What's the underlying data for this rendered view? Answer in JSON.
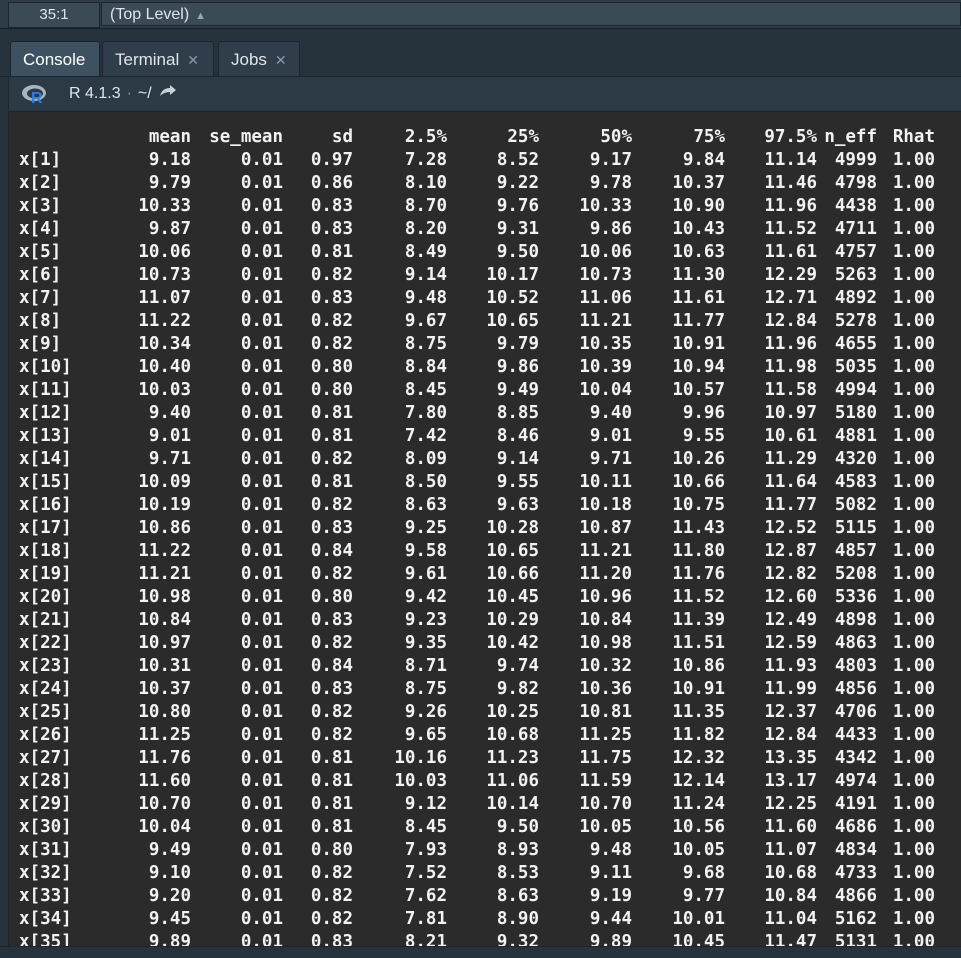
{
  "editor_status": {
    "cursor_position": "35:1",
    "scope": "(Top Level)"
  },
  "tabs": [
    {
      "label": "Console",
      "active": true,
      "closable": false
    },
    {
      "label": "Terminal",
      "active": false,
      "closable": true
    },
    {
      "label": "Jobs",
      "active": false,
      "closable": true
    }
  ],
  "console_toolbar": {
    "r_version": "R 4.1.3",
    "separator": "·",
    "working_dir": "~/"
  },
  "output": {
    "headers": [
      "",
      "mean",
      "se_mean",
      "sd",
      "2.5%",
      "25%",
      "50%",
      "75%",
      "97.5%",
      "n_eff",
      "Rhat"
    ],
    "rows": [
      [
        "x[1]",
        "9.18",
        "0.01",
        "0.97",
        "7.28",
        "8.52",
        "9.17",
        "9.84",
        "11.14",
        "4999",
        "1.00"
      ],
      [
        "x[2]",
        "9.79",
        "0.01",
        "0.86",
        "8.10",
        "9.22",
        "9.78",
        "10.37",
        "11.46",
        "4798",
        "1.00"
      ],
      [
        "x[3]",
        "10.33",
        "0.01",
        "0.83",
        "8.70",
        "9.76",
        "10.33",
        "10.90",
        "11.96",
        "4438",
        "1.00"
      ],
      [
        "x[4]",
        "9.87",
        "0.01",
        "0.83",
        "8.20",
        "9.31",
        "9.86",
        "10.43",
        "11.52",
        "4711",
        "1.00"
      ],
      [
        "x[5]",
        "10.06",
        "0.01",
        "0.81",
        "8.49",
        "9.50",
        "10.06",
        "10.63",
        "11.61",
        "4757",
        "1.00"
      ],
      [
        "x[6]",
        "10.73",
        "0.01",
        "0.82",
        "9.14",
        "10.17",
        "10.73",
        "11.30",
        "12.29",
        "5263",
        "1.00"
      ],
      [
        "x[7]",
        "11.07",
        "0.01",
        "0.83",
        "9.48",
        "10.52",
        "11.06",
        "11.61",
        "12.71",
        "4892",
        "1.00"
      ],
      [
        "x[8]",
        "11.22",
        "0.01",
        "0.82",
        "9.67",
        "10.65",
        "11.21",
        "11.77",
        "12.84",
        "5278",
        "1.00"
      ],
      [
        "x[9]",
        "10.34",
        "0.01",
        "0.82",
        "8.75",
        "9.79",
        "10.35",
        "10.91",
        "11.96",
        "4655",
        "1.00"
      ],
      [
        "x[10]",
        "10.40",
        "0.01",
        "0.80",
        "8.84",
        "9.86",
        "10.39",
        "10.94",
        "11.98",
        "5035",
        "1.00"
      ],
      [
        "x[11]",
        "10.03",
        "0.01",
        "0.80",
        "8.45",
        "9.49",
        "10.04",
        "10.57",
        "11.58",
        "4994",
        "1.00"
      ],
      [
        "x[12]",
        "9.40",
        "0.01",
        "0.81",
        "7.80",
        "8.85",
        "9.40",
        "9.96",
        "10.97",
        "5180",
        "1.00"
      ],
      [
        "x[13]",
        "9.01",
        "0.01",
        "0.81",
        "7.42",
        "8.46",
        "9.01",
        "9.55",
        "10.61",
        "4881",
        "1.00"
      ],
      [
        "x[14]",
        "9.71",
        "0.01",
        "0.82",
        "8.09",
        "9.14",
        "9.71",
        "10.26",
        "11.29",
        "4320",
        "1.00"
      ],
      [
        "x[15]",
        "10.09",
        "0.01",
        "0.81",
        "8.50",
        "9.55",
        "10.11",
        "10.66",
        "11.64",
        "4583",
        "1.00"
      ],
      [
        "x[16]",
        "10.19",
        "0.01",
        "0.82",
        "8.63",
        "9.63",
        "10.18",
        "10.75",
        "11.77",
        "5082",
        "1.00"
      ],
      [
        "x[17]",
        "10.86",
        "0.01",
        "0.83",
        "9.25",
        "10.28",
        "10.87",
        "11.43",
        "12.52",
        "5115",
        "1.00"
      ],
      [
        "x[18]",
        "11.22",
        "0.01",
        "0.84",
        "9.58",
        "10.65",
        "11.21",
        "11.80",
        "12.87",
        "4857",
        "1.00"
      ],
      [
        "x[19]",
        "11.21",
        "0.01",
        "0.82",
        "9.61",
        "10.66",
        "11.20",
        "11.76",
        "12.82",
        "5208",
        "1.00"
      ],
      [
        "x[20]",
        "10.98",
        "0.01",
        "0.80",
        "9.42",
        "10.45",
        "10.96",
        "11.52",
        "12.60",
        "5336",
        "1.00"
      ],
      [
        "x[21]",
        "10.84",
        "0.01",
        "0.83",
        "9.23",
        "10.29",
        "10.84",
        "11.39",
        "12.49",
        "4898",
        "1.00"
      ],
      [
        "x[22]",
        "10.97",
        "0.01",
        "0.82",
        "9.35",
        "10.42",
        "10.98",
        "11.51",
        "12.59",
        "4863",
        "1.00"
      ],
      [
        "x[23]",
        "10.31",
        "0.01",
        "0.84",
        "8.71",
        "9.74",
        "10.32",
        "10.86",
        "11.93",
        "4803",
        "1.00"
      ],
      [
        "x[24]",
        "10.37",
        "0.01",
        "0.83",
        "8.75",
        "9.82",
        "10.36",
        "10.91",
        "11.99",
        "4856",
        "1.00"
      ],
      [
        "x[25]",
        "10.80",
        "0.01",
        "0.82",
        "9.26",
        "10.25",
        "10.81",
        "11.35",
        "12.37",
        "4706",
        "1.00"
      ],
      [
        "x[26]",
        "11.25",
        "0.01",
        "0.82",
        "9.65",
        "10.68",
        "11.25",
        "11.82",
        "12.84",
        "4433",
        "1.00"
      ],
      [
        "x[27]",
        "11.76",
        "0.01",
        "0.81",
        "10.16",
        "11.23",
        "11.75",
        "12.32",
        "13.35",
        "4342",
        "1.00"
      ],
      [
        "x[28]",
        "11.60",
        "0.01",
        "0.81",
        "10.03",
        "11.06",
        "11.59",
        "12.14",
        "13.17",
        "4974",
        "1.00"
      ],
      [
        "x[29]",
        "10.70",
        "0.01",
        "0.81",
        "9.12",
        "10.14",
        "10.70",
        "11.24",
        "12.25",
        "4191",
        "1.00"
      ],
      [
        "x[30]",
        "10.04",
        "0.01",
        "0.81",
        "8.45",
        "9.50",
        "10.05",
        "10.56",
        "11.60",
        "4686",
        "1.00"
      ],
      [
        "x[31]",
        "9.49",
        "0.01",
        "0.80",
        "7.93",
        "8.93",
        "9.48",
        "10.05",
        "11.07",
        "4834",
        "1.00"
      ],
      [
        "x[32]",
        "9.10",
        "0.01",
        "0.82",
        "7.52",
        "8.53",
        "9.11",
        "9.68",
        "10.68",
        "4733",
        "1.00"
      ],
      [
        "x[33]",
        "9.20",
        "0.01",
        "0.82",
        "7.62",
        "8.63",
        "9.19",
        "9.77",
        "10.84",
        "4866",
        "1.00"
      ],
      [
        "x[34]",
        "9.45",
        "0.01",
        "0.82",
        "7.81",
        "8.90",
        "9.44",
        "10.01",
        "11.04",
        "5162",
        "1.00"
      ],
      [
        "x[35]",
        "9.89",
        "0.01",
        "0.83",
        "8.21",
        "9.32",
        "9.89",
        "10.45",
        "11.47",
        "5131",
        "1.00"
      ]
    ]
  }
}
